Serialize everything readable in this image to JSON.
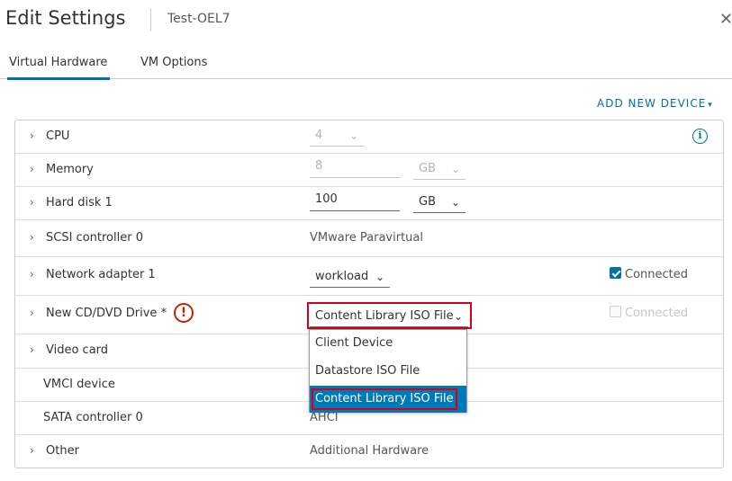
{
  "dialog": {
    "title": "Edit Settings",
    "subtitle": "Test-OEL7",
    "close_icon": "close-icon"
  },
  "tabs": [
    {
      "label": "Virtual Hardware",
      "active": true
    },
    {
      "label": "VM Options",
      "active": false
    }
  ],
  "add_device": {
    "label": "ADD NEW DEVICE",
    "chevron": "⌄"
  },
  "colors": {
    "accent": "#0072a3",
    "error": "#c92100",
    "highlight": "#d6001c",
    "selected_bg": "#0079b8"
  },
  "rows": {
    "cpu": {
      "label": "CPU",
      "value": "4"
    },
    "memory": {
      "label": "Memory",
      "value": "8",
      "unit": "GB"
    },
    "hard_disk": {
      "label": "Hard disk 1",
      "value": "100",
      "unit": "GB"
    },
    "scsi": {
      "label": "SCSI controller 0",
      "value": "VMware Paravirtual"
    },
    "network": {
      "label": "Network adapter 1",
      "value": "workload",
      "connected_label": "Connected",
      "connected": true
    },
    "cdvd": {
      "label": "New CD/DVD Drive *",
      "value": "Content Library ISO File",
      "connected_label": "Connected",
      "connected": false
    },
    "video": {
      "label": "Video card"
    },
    "vmci": {
      "label": "VMCI device"
    },
    "sata": {
      "label": "SATA controller 0",
      "value": "AHCI"
    },
    "other": {
      "label": "Other",
      "value": "Additional Hardware"
    }
  },
  "icons": {
    "expander": "›",
    "dropdown_arrow": "⌄",
    "info": "i",
    "warning": "!"
  },
  "cdvd_dropdown": {
    "options": [
      "Client Device",
      "Datastore ISO File",
      "Content Library ISO File"
    ],
    "selected_index": 2
  }
}
